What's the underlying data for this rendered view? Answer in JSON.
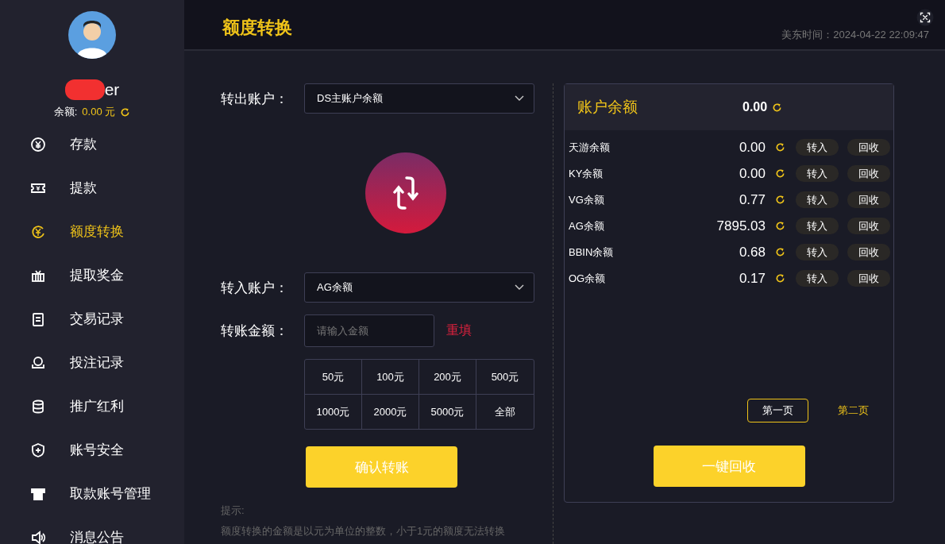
{
  "sidebar": {
    "username": "er",
    "balance_label": "余额:",
    "balance": "0.00 元",
    "items": [
      {
        "label": "存款",
        "kind": "yen",
        "selected": false
      },
      {
        "label": "提款",
        "kind": "ticket",
        "selected": false
      },
      {
        "label": "额度转换",
        "kind": "exchange",
        "selected": true
      },
      {
        "label": "提取奖金",
        "kind": "gift",
        "selected": false
      },
      {
        "label": "交易记录",
        "kind": "clipboard",
        "selected": false
      },
      {
        "label": "投注记录",
        "kind": "chip",
        "selected": false
      },
      {
        "label": "推广红利",
        "kind": "coins",
        "selected": false
      },
      {
        "label": "账号安全",
        "kind": "shield",
        "selected": false
      },
      {
        "label": "取款账号管理",
        "kind": "card",
        "selected": false
      },
      {
        "label": "消息公告",
        "kind": "speaker",
        "selected": false
      }
    ]
  },
  "header": {
    "title": "额度转换",
    "time": "美东时间：2024-04-22 22:09:47"
  },
  "transfer_form": {
    "from_label": "转出账户：",
    "from_value": "DS主账户余额",
    "to_label": "转入账户：",
    "to_value": "AG余额",
    "amount_label": "转账金额：",
    "amount_placeholder": "请输入金额",
    "reset": "重填",
    "presets": [
      "50元",
      "100元",
      "200元",
      "500元",
      "1000元",
      "2000元",
      "5000元",
      "全部"
    ],
    "confirm": "确认转账",
    "hint_title": "提示:",
    "hint": "额度转换的金额是以元为单位的整数，小于1元的额度无法转换"
  },
  "balances": {
    "title": "账户余额",
    "total": "0.00",
    "rows": [
      {
        "name": "天游余额",
        "amount": "0.00",
        "transfer_in": "转入",
        "recover": "回收"
      },
      {
        "name": "KY余额",
        "amount": "0.00",
        "transfer_in": "转入",
        "recover": "回收"
      },
      {
        "name": "VG余额",
        "amount": "0.77",
        "transfer_in": "转入",
        "recover": "回收"
      },
      {
        "name": "AG余额",
        "amount": "7895.03",
        "transfer_in": "转入",
        "recover": "回收"
      },
      {
        "name": "BBIN余额",
        "amount": "0.68",
        "transfer_in": "转入",
        "recover": "回收"
      },
      {
        "name": "OG余额",
        "amount": "0.17",
        "transfer_in": "转入",
        "recover": "回收"
      }
    ],
    "pages": [
      {
        "label": "第一页",
        "selected": true
      },
      {
        "label": "第二页",
        "selected": false
      }
    ],
    "recover_all": "一键回收"
  }
}
